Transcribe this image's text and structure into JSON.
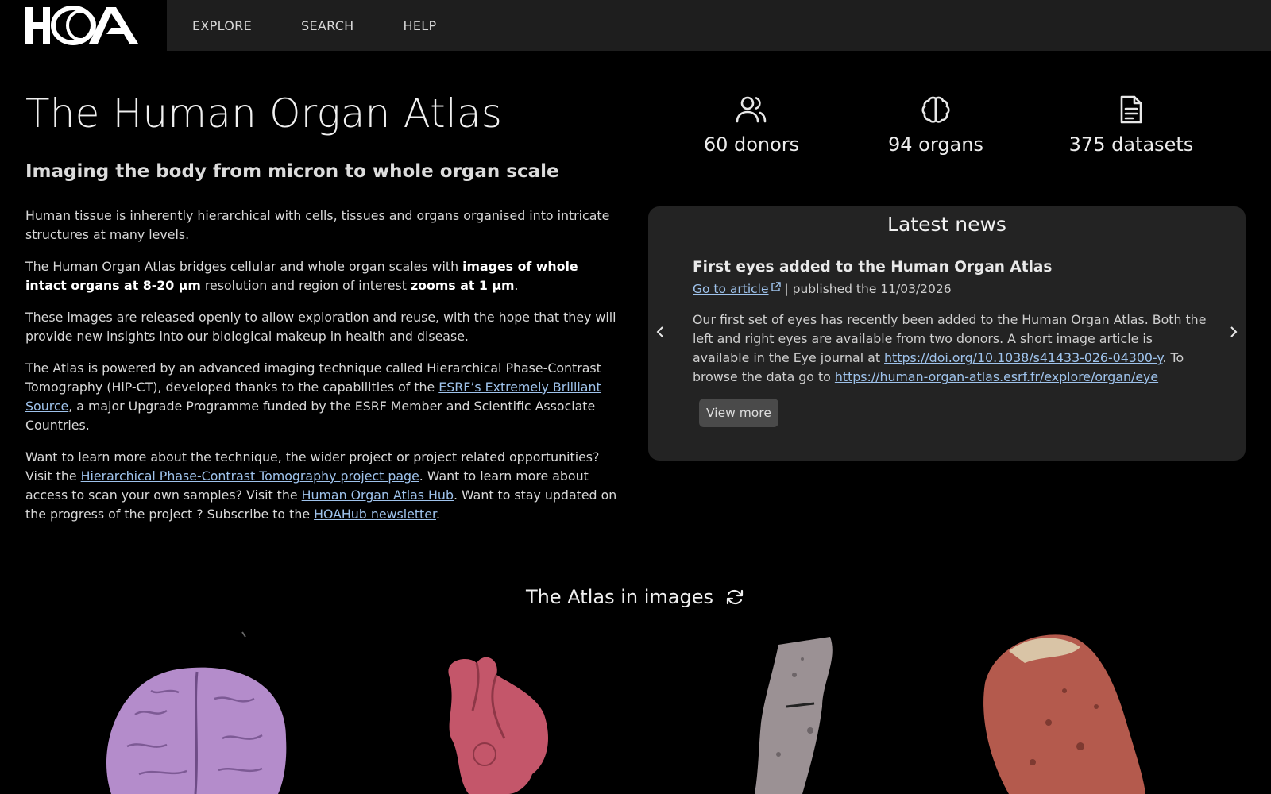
{
  "app": {
    "logo_text": "HOA",
    "logo_icon": "hoa-logo"
  },
  "nav": {
    "items": [
      {
        "label": "EXPLORE"
      },
      {
        "label": "SEARCH"
      },
      {
        "label": "HELP"
      }
    ]
  },
  "main": {
    "title": "The Human Organ Atlas",
    "subtitle": "Imaging the body from micron to whole organ scale",
    "p1": "Human tissue is inherently hierarchical with cells, tissues and organs organised into intricate structures at many levels.",
    "p2_a": "The Human Organ Atlas bridges cellular and whole organ scales with ",
    "p2_b": "images of whole intact organs at 8-20 µm",
    "p2_c": " resolution and region of interest ",
    "p2_d": "zooms at 1 µm",
    "p2_e": ".",
    "p3": "These images are released openly to allow exploration and reuse, with the hope that they will provide new insights into our biological makeup in health and disease.",
    "p4_a": "The Atlas is powered by an advanced imaging technique called Hierarchical Phase-Contrast Tomography (HiP-CT), developed thanks to the capabilities of the ",
    "p4_link": "ESRF’s Extremely Brilliant Source",
    "p4_b": ", a major Upgrade Programme funded by the ESRF Member and Scientific Associate Countries.",
    "p5_a": "Want to learn more about the technique, the wider project or project related opportunities? Visit the ",
    "p5_link1": "Hierarchical Phase-Contrast Tomography project page",
    "p5_b": ". Want to learn more about access to scan your own samples? Visit the ",
    "p5_link2": "Human Organ Atlas Hub",
    "p5_c": ". Want to stay updated on the progress of the project ? Subscribe to the ",
    "p5_link3": "HOAHub newsletter",
    "p5_d": "."
  },
  "stats": [
    {
      "icon": "donors-icon",
      "value": "60 donors"
    },
    {
      "icon": "brain-icon",
      "value": "94 organs"
    },
    {
      "icon": "document-icon",
      "value": "375 datasets"
    }
  ],
  "news": {
    "heading": "Latest news",
    "title": "First eyes added to the Human Organ Atlas",
    "article_link": "Go to article",
    "published": " | published the 11/03/2026",
    "text_a": "Our first set of eyes has recently been added to the Human Organ Atlas. Both the left and right eyes are available from two donors. A short image article is available in the Eye journal at ",
    "doi_link": "https://doi.org/10.1038/s41433-026-04300-y",
    "text_b": ". To browse the data go to ",
    "browse_link": "https://human-organ-atlas.esrf.fr/explore/organ/eye",
    "view_more": "View more",
    "prev_icon": "chevron-left-icon",
    "next_icon": "chevron-right-icon"
  },
  "gallery": {
    "title": "The Atlas in images",
    "refresh_icon": "refresh-icon",
    "tiles": [
      {
        "name": "brain",
        "color": "#b08ac9"
      },
      {
        "name": "heart",
        "color": "#c25a6a"
      },
      {
        "name": "bone",
        "color": "#9a9090"
      },
      {
        "name": "kidney",
        "color": "#b05548"
      }
    ]
  },
  "colors": {
    "background": "#000000",
    "topbar": "#1e1e1e",
    "card": "#232323",
    "link": "#9fc3ec",
    "button": "#4a4a4a"
  }
}
